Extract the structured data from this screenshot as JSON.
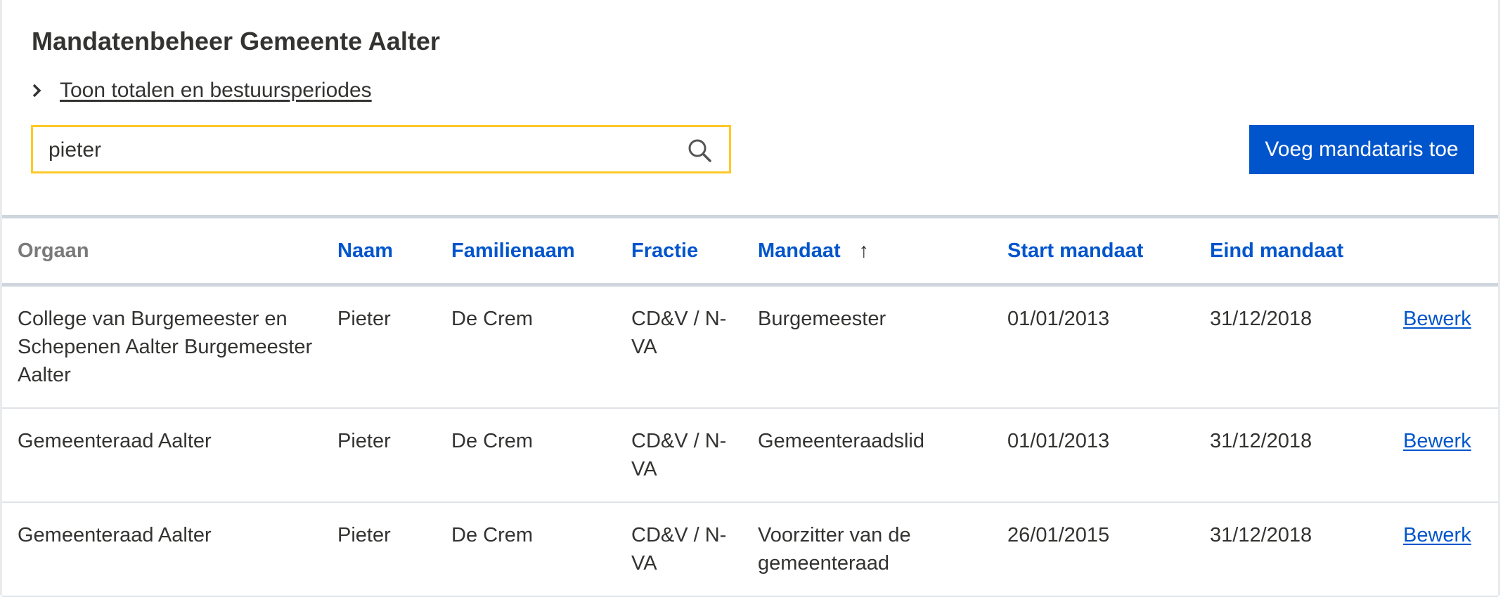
{
  "page_title": "Mandatenbeheer Gemeente Aalter",
  "toggle_label": "Toon totalen en bestuursperiodes",
  "search": {
    "value": "pieter"
  },
  "add_button_label": "Voeg mandataris toe",
  "accent_color": "#0055cc",
  "search_border_color": "#fec927",
  "table": {
    "headers": {
      "orgaan": "Orgaan",
      "naam": "Naam",
      "familienaam": "Familienaam",
      "fractie": "Fractie",
      "mandaat": "Mandaat",
      "mandaat_sort_indicator": "↑",
      "start": "Start mandaat",
      "eind": "Eind mandaat"
    },
    "rows": [
      {
        "orgaan": "College van Burgemeester en Schepenen Aalter Burgemeester Aalter",
        "naam": "Pieter",
        "familienaam": "De Crem",
        "fractie": "CD&V / N-VA",
        "mandaat": "Burgemeester",
        "start": "01/01/2013",
        "eind": "31/12/2018",
        "action": "Bewerk"
      },
      {
        "orgaan": "Gemeenteraad Aalter",
        "naam": "Pieter",
        "familienaam": "De Crem",
        "fractie": "CD&V / N-VA",
        "mandaat": "Gemeenteraadslid",
        "start": "01/01/2013",
        "eind": "31/12/2018",
        "action": "Bewerk"
      },
      {
        "orgaan": "Gemeenteraad Aalter",
        "naam": "Pieter",
        "familienaam": "De Crem",
        "fractie": "CD&V / N-VA",
        "mandaat": "Voorzitter van de gemeenteraad",
        "start": "26/01/2015",
        "eind": "31/12/2018",
        "action": "Bewerk"
      }
    ]
  }
}
